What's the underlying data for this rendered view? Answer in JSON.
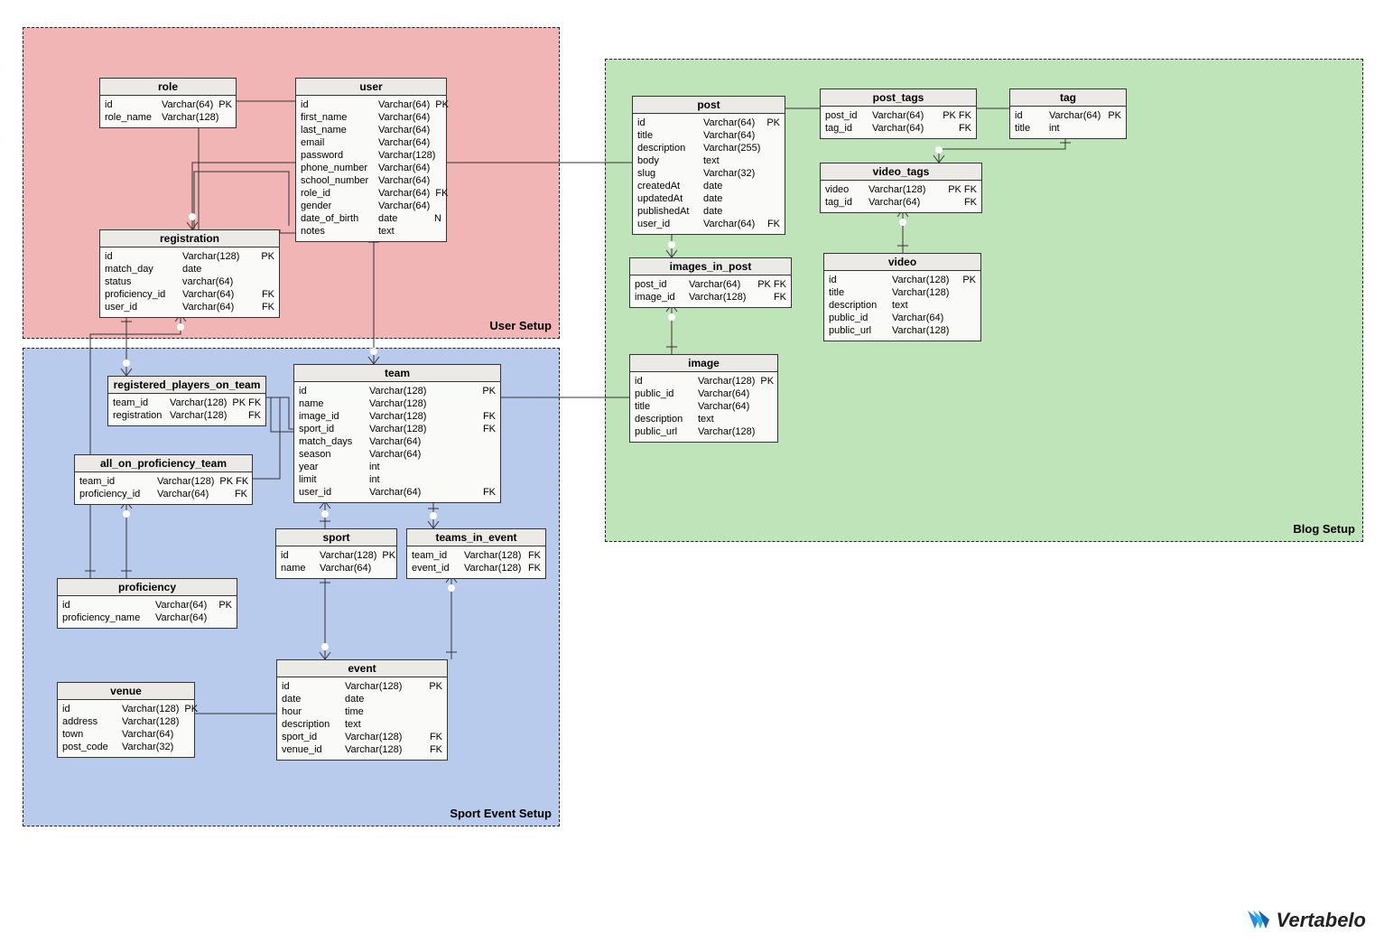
{
  "regions": {
    "user_setup": "User Setup",
    "sport_setup": "Sport Event Setup",
    "blog_setup": "Blog Setup"
  },
  "tables": {
    "role": {
      "title": "role",
      "rows": [
        {
          "name": "id",
          "type": "Varchar(64)",
          "flag": "PK"
        },
        {
          "name": "role_name",
          "type": "Varchar(128)",
          "flag": ""
        }
      ]
    },
    "user": {
      "title": "user",
      "rows": [
        {
          "name": "id",
          "type": "Varchar(64)",
          "flag": "PK"
        },
        {
          "name": "first_name",
          "type": "Varchar(64)",
          "flag": ""
        },
        {
          "name": "last_name",
          "type": "Varchar(64)",
          "flag": ""
        },
        {
          "name": "email",
          "type": "Varchar(64)",
          "flag": ""
        },
        {
          "name": "password",
          "type": "Varchar(128)",
          "flag": ""
        },
        {
          "name": "phone_number",
          "type": "Varchar(64)",
          "flag": ""
        },
        {
          "name": "school_number",
          "type": "Varchar(64)",
          "flag": ""
        },
        {
          "name": "role_id",
          "type": "Varchar(64)",
          "flag": "FK"
        },
        {
          "name": "gender",
          "type": "Varchar(64)",
          "flag": ""
        },
        {
          "name": "date_of_birth",
          "type": "date",
          "flag": "N"
        },
        {
          "name": "notes",
          "type": "text",
          "flag": ""
        }
      ]
    },
    "registration": {
      "title": "registration",
      "rows": [
        {
          "name": "id",
          "type": "Varchar(128)",
          "flag": "PK"
        },
        {
          "name": "match_day",
          "type": "date",
          "flag": ""
        },
        {
          "name": "status",
          "type": "varchar(64)",
          "flag": ""
        },
        {
          "name": "proficiency_id",
          "type": "Varchar(64)",
          "flag": "FK"
        },
        {
          "name": "user_id",
          "type": "Varchar(64)",
          "flag": "FK"
        }
      ]
    },
    "rpot": {
      "title": "registered_players_on_team",
      "rows": [
        {
          "name": "team_id",
          "type": "Varchar(128)",
          "flag": "PK FK"
        },
        {
          "name": "registration",
          "type": "Varchar(128)",
          "flag": "FK"
        }
      ]
    },
    "aopt": {
      "title": "all_on_proficiency_team",
      "rows": [
        {
          "name": "team_id",
          "type": "Varchar(128)",
          "flag": "PK FK"
        },
        {
          "name": "proficiency_id",
          "type": "Varchar(64)",
          "flag": "FK"
        }
      ]
    },
    "proficiency": {
      "title": "proficiency",
      "rows": [
        {
          "name": "id",
          "type": "Varchar(64)",
          "flag": "PK"
        },
        {
          "name": "proficiency_name",
          "type": "Varchar(64)",
          "flag": ""
        }
      ]
    },
    "team": {
      "title": "team",
      "rows": [
        {
          "name": "id",
          "type": "Varchar(128)",
          "flag": "PK"
        },
        {
          "name": "name",
          "type": "Varchar(128)",
          "flag": ""
        },
        {
          "name": "image_id",
          "type": "Varchar(128)",
          "flag": "FK"
        },
        {
          "name": "sport_id",
          "type": "Varchar(128)",
          "flag": "FK"
        },
        {
          "name": "match_days",
          "type": "Varchar(64)",
          "flag": ""
        },
        {
          "name": "season",
          "type": "Varchar(64)",
          "flag": ""
        },
        {
          "name": "year",
          "type": "int",
          "flag": ""
        },
        {
          "name": "limit",
          "type": "int",
          "flag": ""
        },
        {
          "name": "user_id",
          "type": "Varchar(64)",
          "flag": "FK"
        }
      ]
    },
    "sport": {
      "title": "sport",
      "rows": [
        {
          "name": "id",
          "type": "Varchar(128)",
          "flag": "PK"
        },
        {
          "name": "name",
          "type": "Varchar(64)",
          "flag": ""
        }
      ]
    },
    "teams_in_event": {
      "title": "teams_in_event",
      "rows": [
        {
          "name": "team_id",
          "type": "Varchar(128)",
          "flag": "FK"
        },
        {
          "name": "event_id",
          "type": "Varchar(128)",
          "flag": "FK"
        }
      ]
    },
    "venue": {
      "title": "venue",
      "rows": [
        {
          "name": "id",
          "type": "Varchar(128)",
          "flag": "PK"
        },
        {
          "name": "address",
          "type": "Varchar(128)",
          "flag": ""
        },
        {
          "name": "town",
          "type": "Varchar(64)",
          "flag": ""
        },
        {
          "name": "post_code",
          "type": "Varchar(32)",
          "flag": ""
        }
      ]
    },
    "event": {
      "title": "event",
      "rows": [
        {
          "name": "id",
          "type": "Varchar(128)",
          "flag": "PK"
        },
        {
          "name": "date",
          "type": "date",
          "flag": ""
        },
        {
          "name": "hour",
          "type": "time",
          "flag": ""
        },
        {
          "name": "description",
          "type": "text",
          "flag": ""
        },
        {
          "name": "sport_id",
          "type": "Varchar(128)",
          "flag": "FK"
        },
        {
          "name": "venue_id",
          "type": "Varchar(128)",
          "flag": "FK"
        }
      ]
    },
    "post": {
      "title": "post",
      "rows": [
        {
          "name": "id",
          "type": "Varchar(64)",
          "flag": "PK"
        },
        {
          "name": "title",
          "type": "Varchar(64)",
          "flag": ""
        },
        {
          "name": "description",
          "type": "Varchar(255)",
          "flag": ""
        },
        {
          "name": "body",
          "type": "text",
          "flag": ""
        },
        {
          "name": "slug",
          "type": "Varchar(32)",
          "flag": ""
        },
        {
          "name": "createdAt",
          "type": "date",
          "flag": ""
        },
        {
          "name": "updatedAt",
          "type": "date",
          "flag": ""
        },
        {
          "name": "publishedAt",
          "type": "date",
          "flag": ""
        },
        {
          "name": "user_id",
          "type": "Varchar(64)",
          "flag": "FK"
        }
      ]
    },
    "images_in_post": {
      "title": "images_in_post",
      "rows": [
        {
          "name": "post_id",
          "type": "Varchar(64)",
          "flag": "PK FK"
        },
        {
          "name": "image_id",
          "type": "Varchar(128)",
          "flag": "FK"
        }
      ]
    },
    "image": {
      "title": "image",
      "rows": [
        {
          "name": "id",
          "type": "Varchar(128)",
          "flag": "PK"
        },
        {
          "name": "public_id",
          "type": "Varchar(64)",
          "flag": ""
        },
        {
          "name": "title",
          "type": "Varchar(64)",
          "flag": ""
        },
        {
          "name": "description",
          "type": "text",
          "flag": ""
        },
        {
          "name": "public_url",
          "type": "Varchar(128)",
          "flag": ""
        }
      ]
    },
    "post_tags": {
      "title": "post_tags",
      "rows": [
        {
          "name": "post_id",
          "type": "Varchar(64)",
          "flag": "PK FK"
        },
        {
          "name": "tag_id",
          "type": "Varchar(64)",
          "flag": "FK"
        }
      ]
    },
    "tag": {
      "title": "tag",
      "rows": [
        {
          "name": "id",
          "type": "Varchar(64)",
          "flag": "PK"
        },
        {
          "name": "title",
          "type": "int",
          "flag": ""
        }
      ]
    },
    "video_tags": {
      "title": "video_tags",
      "rows": [
        {
          "name": "video",
          "type": "Varchar(128)",
          "flag": "PK FK"
        },
        {
          "name": "tag_id",
          "type": "Varchar(64)",
          "flag": "FK"
        }
      ]
    },
    "video": {
      "title": "video",
      "rows": [
        {
          "name": "id",
          "type": "Varchar(128)",
          "flag": "PK"
        },
        {
          "name": "title",
          "type": "Varchar(128)",
          "flag": ""
        },
        {
          "name": "description",
          "type": "text",
          "flag": ""
        },
        {
          "name": "public_id",
          "type": "Varchar(64)",
          "flag": ""
        },
        {
          "name": "public_url",
          "type": "Varchar(128)",
          "flag": ""
        }
      ]
    }
  },
  "logo": "Vertabelo"
}
